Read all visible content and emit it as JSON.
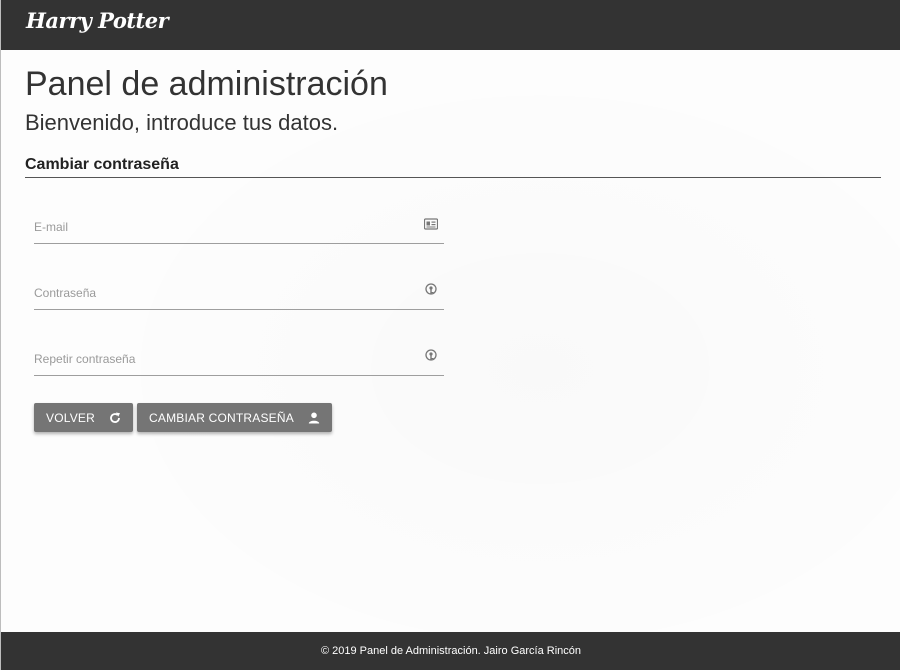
{
  "header": {
    "logo_text": "Harry Potter"
  },
  "main": {
    "title": "Panel de administración",
    "subtitle": "Bienvenido, introduce tus datos.",
    "section_title": "Cambiar contraseña"
  },
  "form": {
    "email": {
      "placeholder": "E-mail",
      "icon": "id-card-icon"
    },
    "password": {
      "placeholder": "Contraseña",
      "icon": "key-icon"
    },
    "repeat_password": {
      "placeholder": "Repetir contraseña",
      "icon": "key-icon"
    }
  },
  "buttons": {
    "back_label": "VOLVER",
    "back_icon": "refresh-icon",
    "change_label": "CAMBIAR CONTRASEÑA",
    "change_icon": "user-icon"
  },
  "footer": {
    "text": "© 2019 Panel de Administración. Jairo García Rincón"
  },
  "colors": {
    "topbar": "#333333",
    "button": "#757575",
    "footer": "#333333"
  }
}
